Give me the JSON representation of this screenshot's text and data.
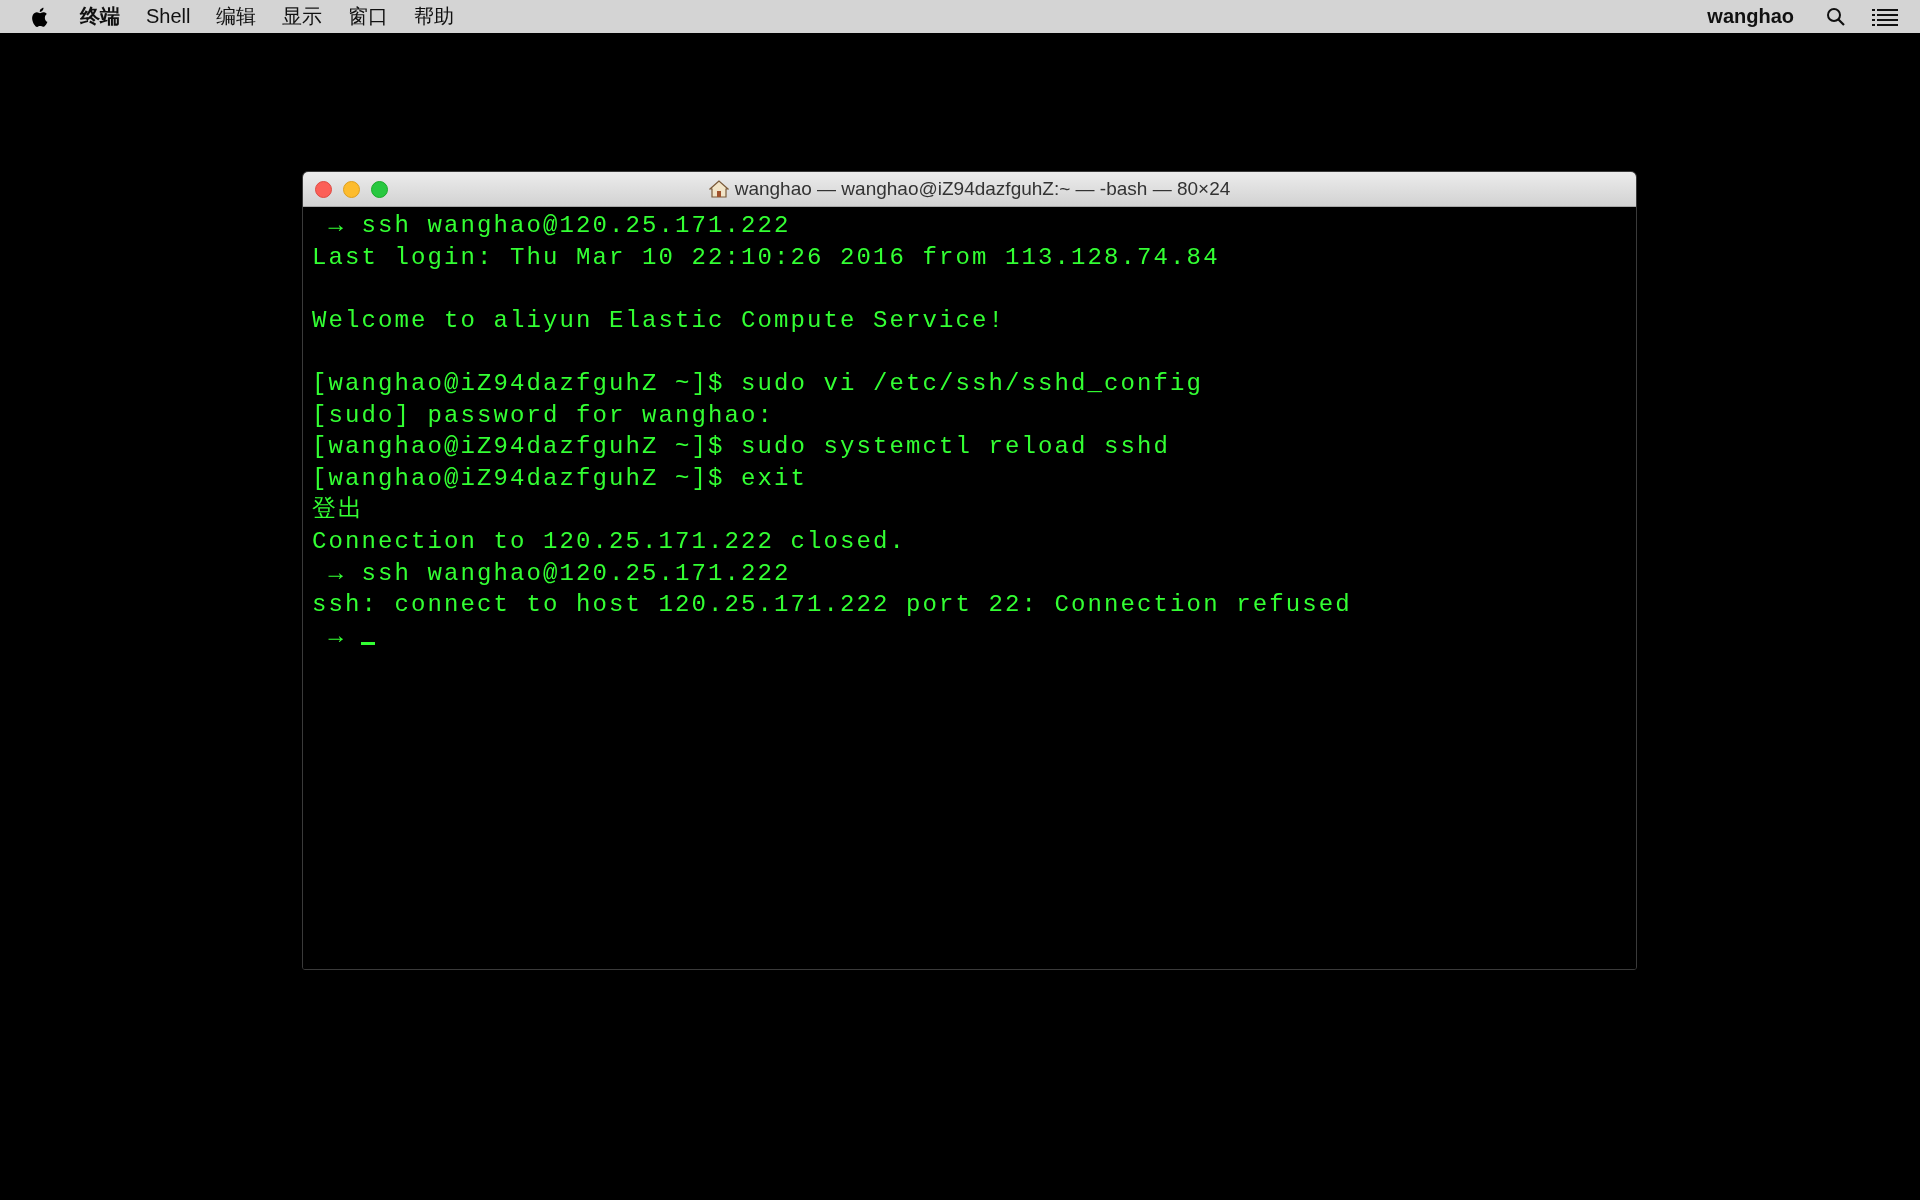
{
  "menu_bar": {
    "app": "终端",
    "items": [
      "Shell",
      "编辑",
      "显示",
      "窗口",
      "帮助"
    ],
    "user": "wanghao"
  },
  "window": {
    "title": "wanghao — wanghao@iZ94dazfguhZ:~ — -bash — 80×24"
  },
  "terminal": {
    "lines": [
      {
        "kind": "text",
        "text": " → ssh wanghao@120.25.171.222"
      },
      {
        "kind": "text",
        "text": "Last login: Thu Mar 10 22:10:26 2016 from 113.128.74.84"
      },
      {
        "kind": "blank"
      },
      {
        "kind": "text",
        "text": "Welcome to aliyun Elastic Compute Service!"
      },
      {
        "kind": "blank"
      },
      {
        "kind": "text",
        "text": "[wanghao@iZ94dazfguhZ ~]$ sudo vi /etc/ssh/sshd_config"
      },
      {
        "kind": "text",
        "text": "[sudo] password for wanghao:"
      },
      {
        "kind": "text",
        "text": "[wanghao@iZ94dazfguhZ ~]$ sudo systemctl reload sshd"
      },
      {
        "kind": "text",
        "text": "[wanghao@iZ94dazfguhZ ~]$ exit"
      },
      {
        "kind": "text",
        "text": "登出"
      },
      {
        "kind": "text",
        "text": "Connection to 120.25.171.222 closed."
      },
      {
        "kind": "text",
        "text": " → ssh wanghao@120.25.171.222"
      },
      {
        "kind": "text",
        "text": "ssh: connect to host 120.25.171.222 port 22: Connection refused"
      },
      {
        "kind": "text",
        "text": " →"
      }
    ],
    "cursor": true
  }
}
